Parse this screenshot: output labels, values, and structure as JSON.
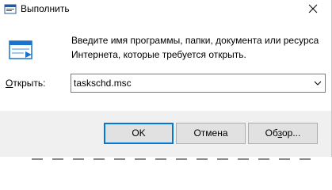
{
  "window": {
    "title": "Выполнить"
  },
  "content": {
    "description": "Введите имя программы, папки, документа или ресурса Интернета, которые требуется открыть.",
    "open_label": "Открыть:",
    "open_accesskey": "О",
    "open_label_rest": "ткрыть:",
    "open_value": "taskschd.msc"
  },
  "buttons": {
    "ok": "OK",
    "cancel": "Отмена",
    "browse_prefix": "Об",
    "browse_accesskey": "з",
    "browse_suffix": "ор..."
  },
  "icons": {
    "app": "run-dialog-icon",
    "close": "close-icon",
    "run": "run-program-icon",
    "dropdown": "chevron-down-icon"
  },
  "colors": {
    "focus_border": "#0078d7",
    "footer_bg": "#f0f0f0",
    "button_bg": "#e1e1e1"
  }
}
